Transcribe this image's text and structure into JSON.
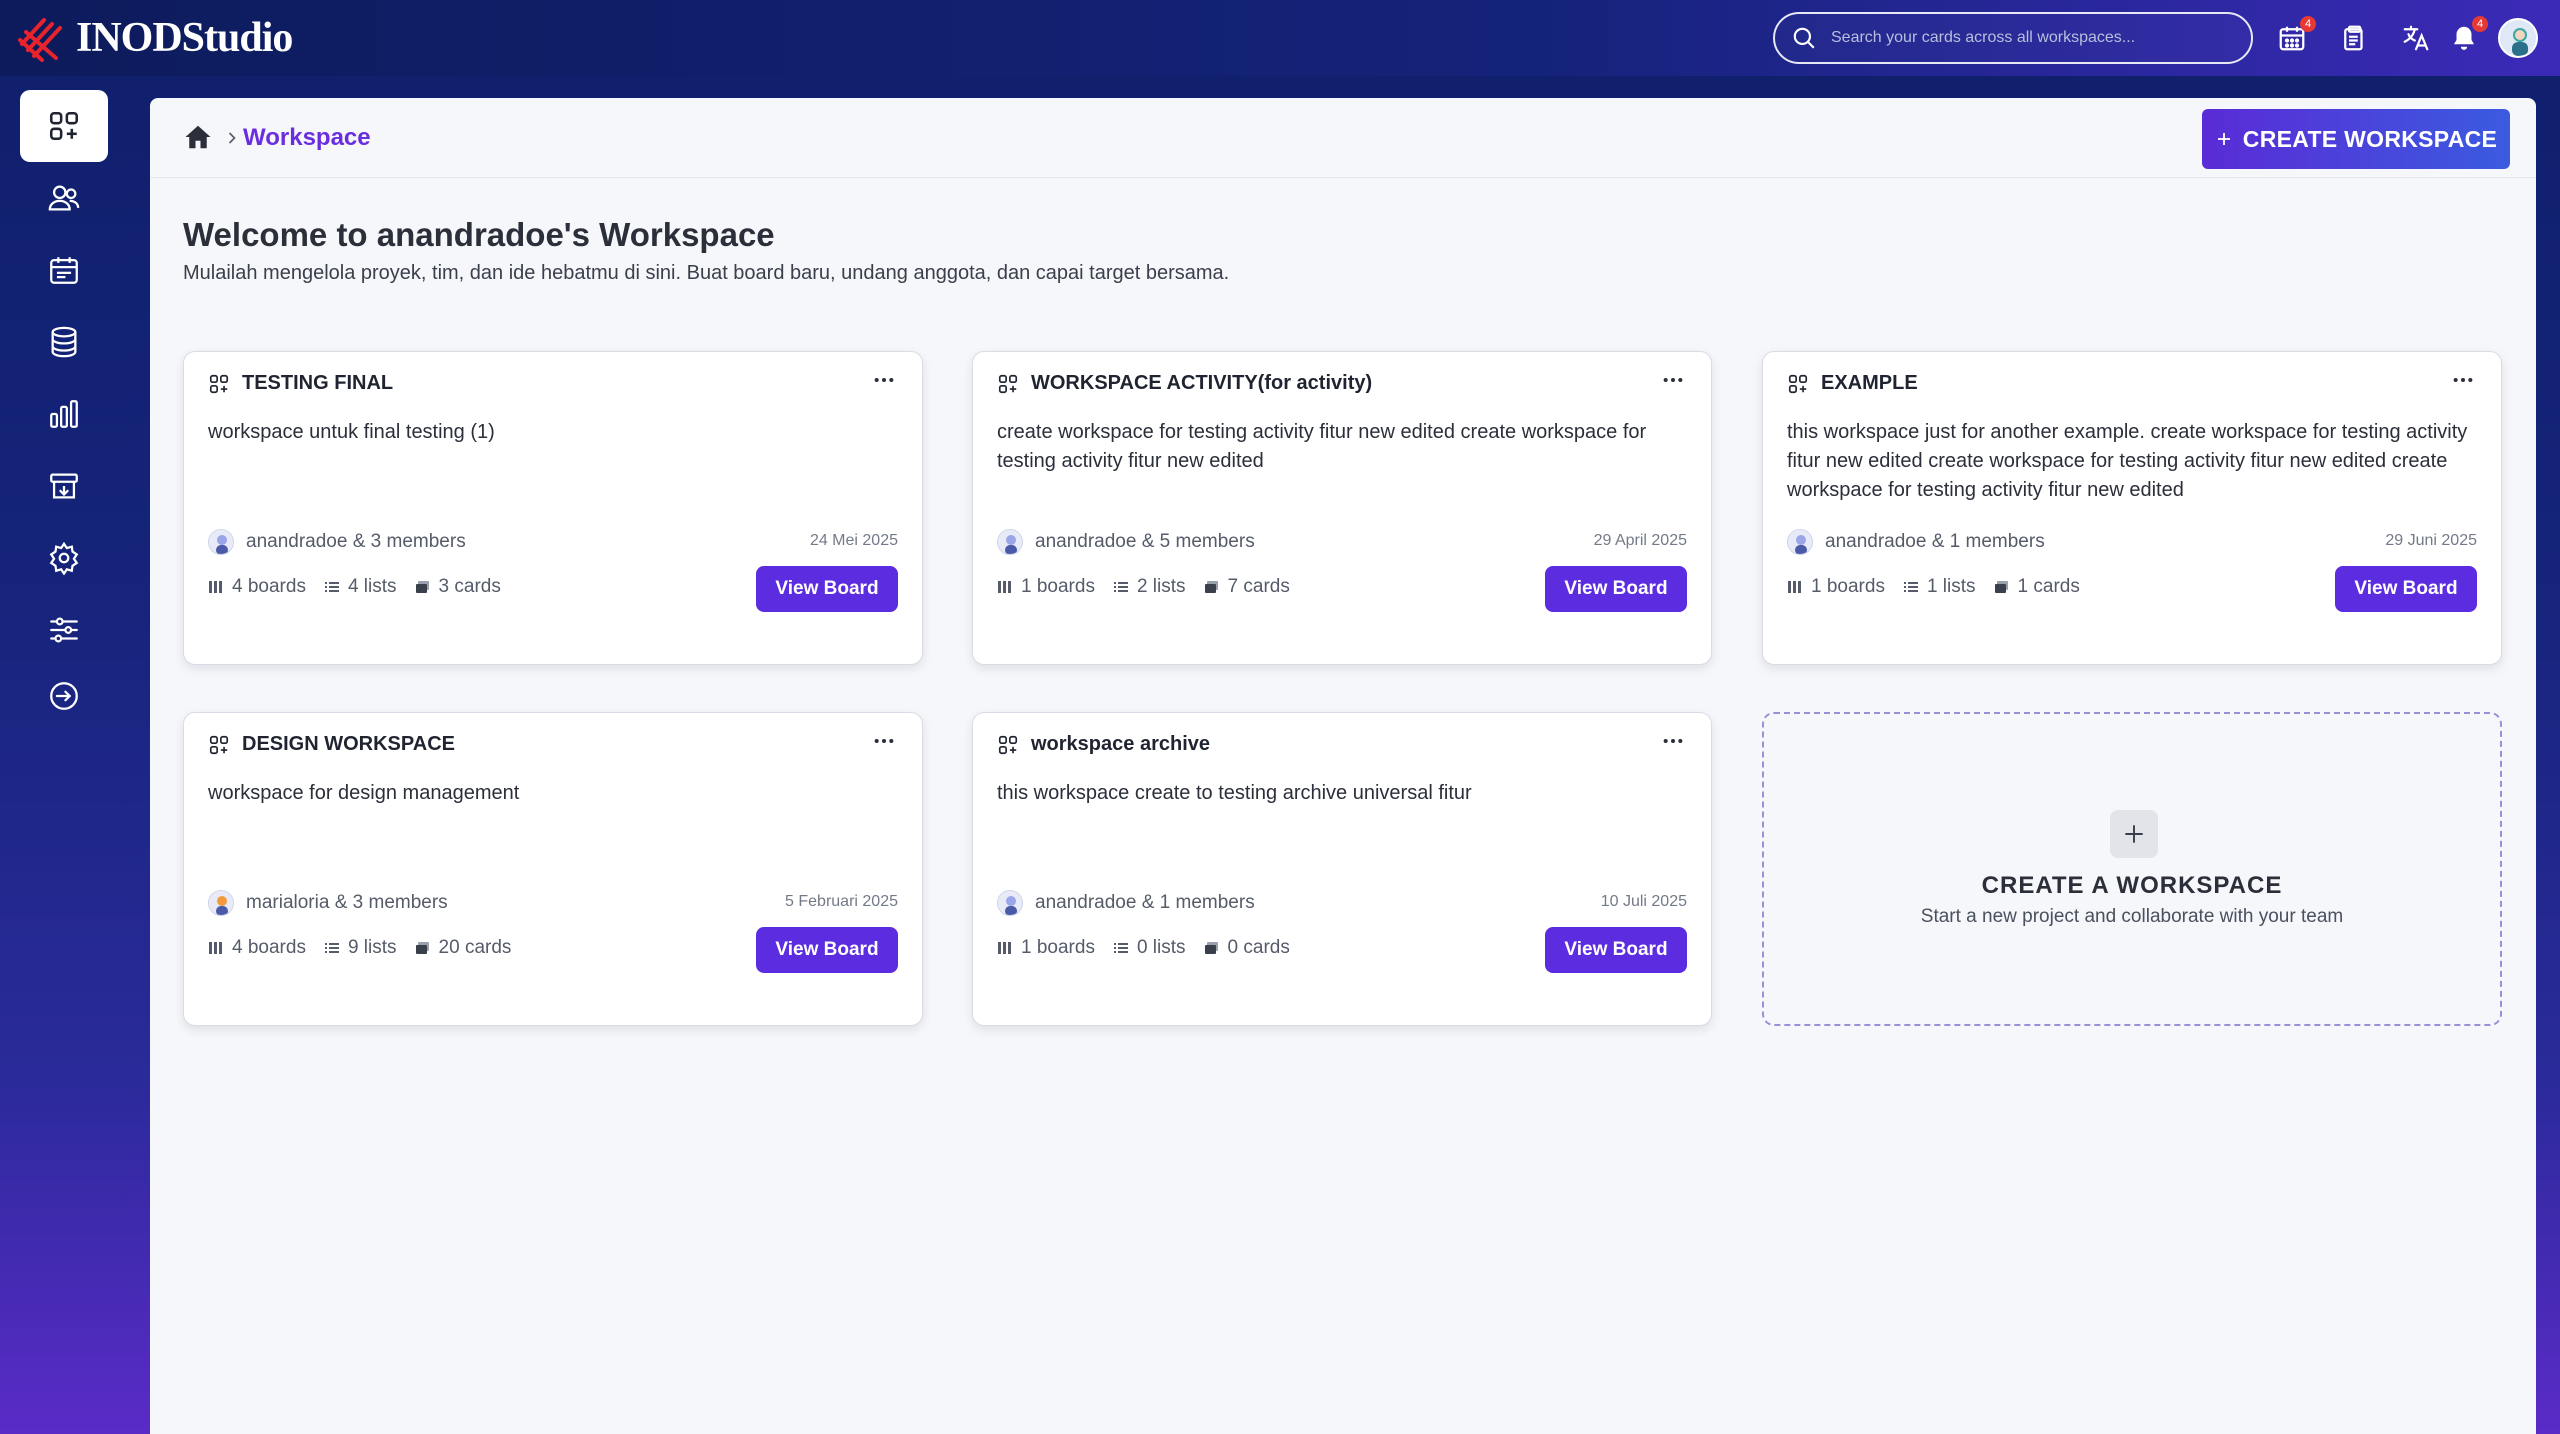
{
  "app": {
    "logo_text": "INODStudio",
    "search_placeholder": "Search your cards across all workspaces...",
    "calendar_badge": "4",
    "notification_badge": "4"
  },
  "sidebar": {
    "items": [
      {
        "icon": "workspace-grid-icon",
        "active": true
      },
      {
        "icon": "users-icon",
        "active": false
      },
      {
        "icon": "calendar-icon",
        "active": false
      },
      {
        "icon": "database-icon",
        "active": false
      },
      {
        "icon": "bar-chart-icon",
        "active": false
      },
      {
        "icon": "archive-icon",
        "active": false
      },
      {
        "icon": "gear-icon",
        "active": false
      },
      {
        "icon": "sliders-icon",
        "active": false
      },
      {
        "icon": "logout-arrow-icon",
        "active": false
      }
    ]
  },
  "breadcrumb": {
    "current": "Workspace"
  },
  "header": {
    "create_button": "CREATE WORKSPACE",
    "title": "Welcome to anandradoe's Workspace",
    "subtitle": "Mulailah mengelola proyek, tim, dan ide hebatmu di sini. Buat board baru, undang anggota, dan capai target bersama."
  },
  "workspaces": [
    {
      "name": "TESTING FINAL",
      "description": "workspace untuk final testing (1)",
      "members": "anandradoe & 3 members",
      "date": "24 Mei 2025",
      "boards": "4 boards",
      "lists": "4 lists",
      "cards": "3 cards",
      "button": "View Board"
    },
    {
      "name": "WORKSPACE ACTIVITY(for activity)",
      "description": "create workspace for testing activity fitur new edited create workspace for testing activity fitur new edited",
      "members": "anandradoe & 5 members",
      "date": "29 April 2025",
      "boards": "1 boards",
      "lists": "2 lists",
      "cards": "7 cards",
      "button": "View Board"
    },
    {
      "name": "EXAMPLE",
      "description": "this workspace just for another example. create workspace for testing activity fitur new edited create workspace for testing activity fitur new edited create workspace for testing activity fitur new edited",
      "members": "anandradoe & 1 members",
      "date": "29 Juni 2025",
      "boards": "1 boards",
      "lists": "1 lists",
      "cards": "1 cards",
      "button": "View Board"
    },
    {
      "name": "DESIGN WORKSPACE",
      "description": "workspace for design management",
      "members": "marialoria & 3 members",
      "date": "5 Februari 2025",
      "boards": "4 boards",
      "lists": "9 lists",
      "cards": "20 cards",
      "button": "View Board"
    },
    {
      "name": "workspace archive",
      "description": "this workspace create to testing archive universal fitur",
      "members": "anandradoe & 1 members",
      "date": "10 Juli 2025",
      "boards": "1 boards",
      "lists": "0 lists",
      "cards": "0 cards",
      "button": "View Board"
    }
  ],
  "create_card": {
    "title": "CREATE A WORKSPACE",
    "subtitle": "Start a new project and collaborate with your team"
  },
  "colors": {
    "accent": "#5b2ce0",
    "breadcrumb": "#6a2ee0",
    "topbar": "#0d1b5c"
  }
}
